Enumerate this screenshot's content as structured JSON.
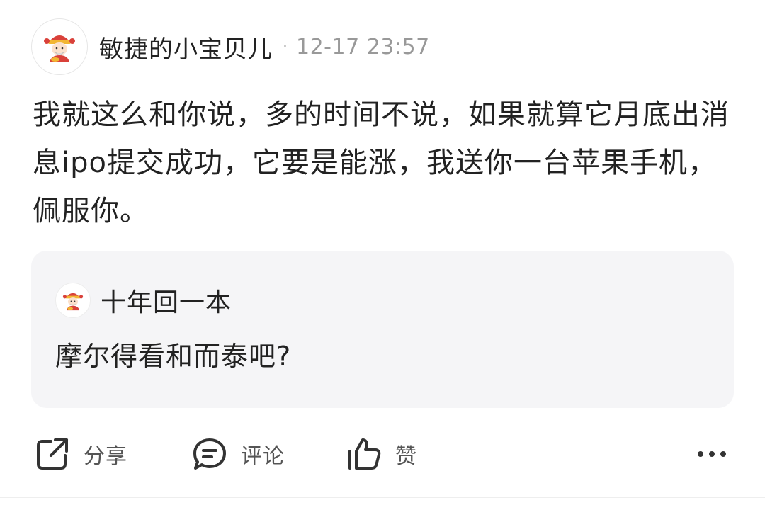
{
  "post": {
    "author_name": "敏捷的小宝贝儿",
    "separator": "·",
    "time": "12-17 23:57",
    "content": "我就这么和你说，多的时间不说，如果就算它月底出消息ipo提交成功，它要是能涨，我送你一台苹果手机，佩服你。"
  },
  "quote": {
    "author_name": "十年回一本",
    "text": "摩尔得看和而泰吧?"
  },
  "actions": {
    "share_label": "分享",
    "comment_label": "评论",
    "like_label": "赞"
  },
  "icons": {
    "avatar": "caishen-avatar-icon",
    "share": "share-icon",
    "comment": "comment-icon",
    "like": "thumbs-up-icon",
    "more": "more-icon"
  },
  "colors": {
    "text_primary": "#222222",
    "text_secondary": "#999999",
    "card_background": "#f5f5f7",
    "icon_stroke": "#333333"
  }
}
